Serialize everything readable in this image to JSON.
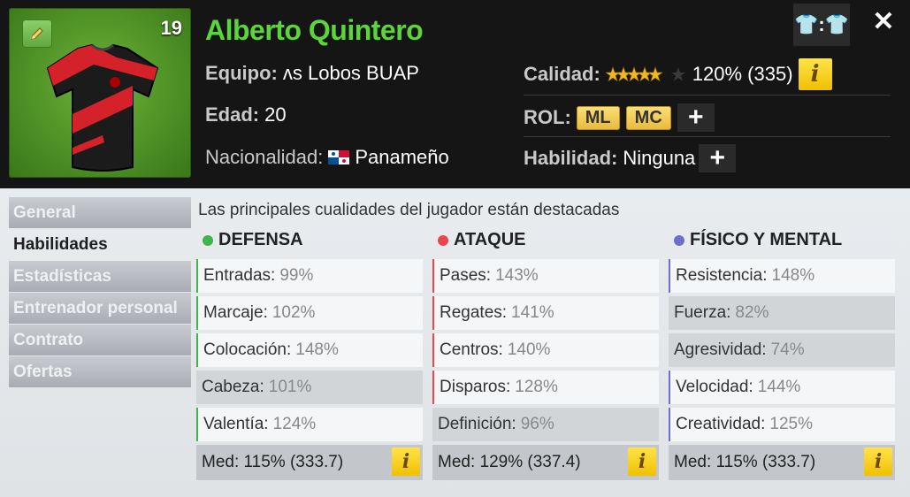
{
  "player": {
    "number": "19",
    "name": "Alberto Quintero"
  },
  "info": {
    "team_label": "Equipo:",
    "team_value": "ʌs Lobos BUAP",
    "age_label": "Edad:",
    "age_value": "20",
    "nationality_label": "Nacionalidad:",
    "nationality_value": "Panameño",
    "quality_label": "Calidad:",
    "quality_value": "120% (335)",
    "role_label": "ROL:",
    "roles": [
      "ML",
      "MC"
    ],
    "skill_label": "Habilidad:",
    "skill_value": "Ninguna"
  },
  "header_buttons": {
    "shirts": "👕:👕",
    "close": "✕",
    "info": "i",
    "plus": "+"
  },
  "tabs": [
    "General",
    "Habilidades",
    "Estadísticas",
    "Entrenador personal",
    "Contrato",
    "Ofertas"
  ],
  "subtitle": "Las principales cualidades del jugador están destacadas",
  "columns": [
    {
      "title": "DEFENSA",
      "color": "#3cb54a",
      "attrs": [
        {
          "label": "Entradas:",
          "value": "99%"
        },
        {
          "label": "Marcaje:",
          "value": "102%"
        },
        {
          "label": "Colocación:",
          "value": "148%"
        },
        {
          "label": "Cabeza:",
          "value": "101%"
        },
        {
          "label": "Valentía:",
          "value": "124%"
        }
      ],
      "avg": "Med: 115% (333.7)"
    },
    {
      "title": "ATAQUE",
      "color": "#e8474b",
      "attrs": [
        {
          "label": "Pases:",
          "value": "143%"
        },
        {
          "label": "Regates:",
          "value": "141%"
        },
        {
          "label": "Centros:",
          "value": "140%"
        },
        {
          "label": "Disparos:",
          "value": "128%"
        },
        {
          "label": "Definición:",
          "value": "96%"
        }
      ],
      "avg": "Med: 129% (337.4)"
    },
    {
      "title": "FÍSICO Y MENTAL",
      "color": "#6b6fd0",
      "attrs": [
        {
          "label": "Resistencia:",
          "value": "148%"
        },
        {
          "label": "Fuerza:",
          "value": "82%"
        },
        {
          "label": "Agresividad:",
          "value": "74%"
        },
        {
          "label": "Velocidad:",
          "value": "144%"
        },
        {
          "label": "Creatividad:",
          "value": "125%"
        }
      ],
      "avg": "Med: 115% (333.7)"
    }
  ]
}
